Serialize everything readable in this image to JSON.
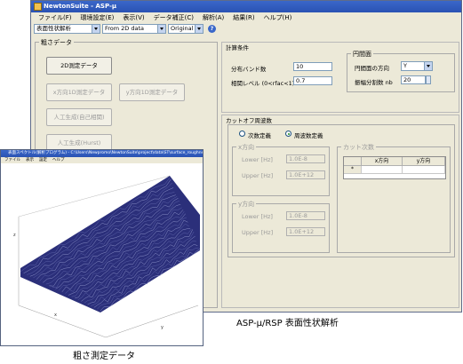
{
  "window": {
    "title": "NewtonSuite - ASP-μ"
  },
  "menu": {
    "items": [
      "ファイル(F)",
      "環境設定(E)",
      "表示(V)",
      "データ補正(C)",
      "解析(A)",
      "結果(R)",
      "ヘルプ(H)"
    ]
  },
  "toolbar": {
    "mode_select": "表面性状解析",
    "source_select": "From 2D data",
    "view_select": "Original"
  },
  "rough_data": {
    "group_title": "粗さデータ",
    "btn_2d": "2D測定データ",
    "btn_x1d": "x方向1D測定データ",
    "btn_y1d": "y方向1D測定データ",
    "btn_artificial_self": "人工生成(自己相関)",
    "btn_artificial_hurst": "人工生成(Hurst)"
  },
  "calc_conditions": {
    "group_title": "計算条件",
    "band_label": "分布バンド数",
    "band_value": "10",
    "corr_label": "相関レベル (0<rfac<1)",
    "corr_value": "0.7",
    "circ_group_title": "円間面",
    "circ_dir_label": "円間面の方向",
    "circ_dir_value": "Y",
    "div_label": "振幅分割数 nb",
    "div_value": "20"
  },
  "cutoff": {
    "group_title": "カットオフ周波数",
    "radio_order": "次数定義",
    "radio_freq": "周波数定義",
    "x_title": "x方向",
    "y_title": "y方向",
    "lower_label": "Lower [Hz]",
    "upper_label": "Upper [Hz]",
    "x_lower": "1.0E-8",
    "x_upper": "1.0E+12",
    "y_lower": "1.0E-8",
    "y_upper": "1.0E+12",
    "order_title": "カット次数",
    "col_x": "x方向",
    "col_y": "y方向",
    "row_marker": "*"
  },
  "plot_window": {
    "title": "表面スペクトル(解析プログラム) - C:\\Users\\Newpromo\\NewtonSuite\\project\\data\\ST\\surface_roughness\\Rough_D0110.txt",
    "menu": [
      "ファイル",
      "表示",
      "設定",
      "ヘルプ"
    ],
    "z_label": "z",
    "x_label": "x",
    "y_label": "y"
  },
  "captions": {
    "right": "ASP-μ/RSP 表面性状解析",
    "left": "粗さ測定データ"
  },
  "colors": {
    "titlebar": "#2a52b3",
    "window_bg": "#ece9d8",
    "surface": "#2b2f7a"
  }
}
